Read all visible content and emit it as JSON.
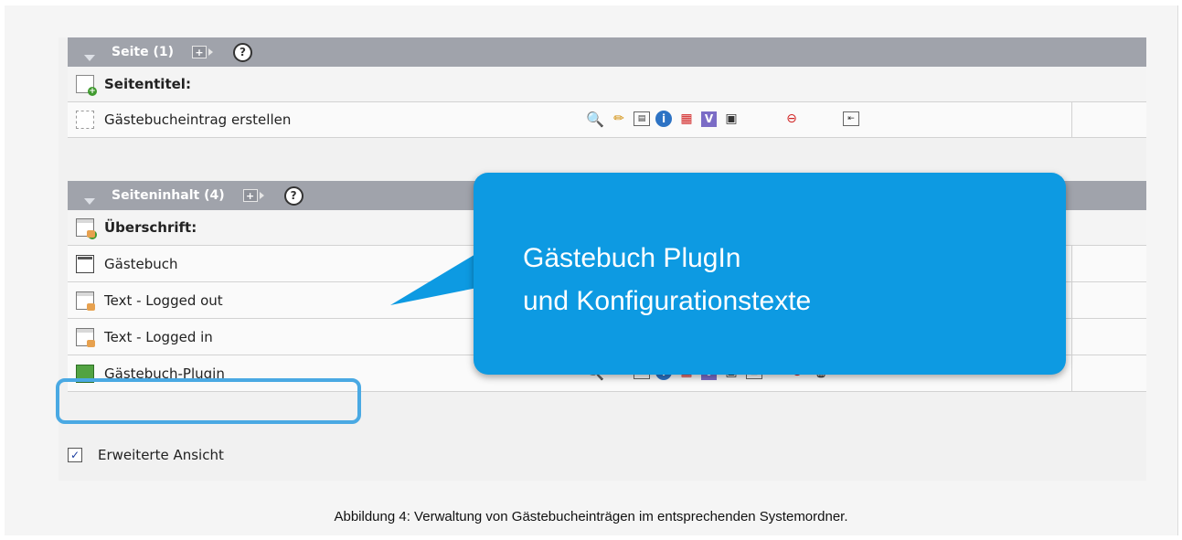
{
  "sections": [
    {
      "title": "Seite (1)",
      "help": "?",
      "head_label": "Seitentitel:",
      "rows": [
        {
          "label": "Gästebucheintrag erstellen"
        }
      ]
    },
    {
      "title": "Seiteninhalt (4)",
      "help": "?",
      "head_label": "Überschrift:",
      "rows": [
        {
          "label": "Gästebuch"
        },
        {
          "label": "Text - Logged out"
        },
        {
          "label": "Text - Logged in"
        },
        {
          "label": "Gästebuch-Plugin"
        }
      ]
    }
  ],
  "row_icons": [
    "magnifier-icon",
    "pencil-icon",
    "page-move-icon",
    "info-icon",
    "calendar-icon",
    "v-icon",
    "new-content-icon",
    "hide-icon",
    "move-up-icon"
  ],
  "toolbar_glyphs": {
    "v": "V",
    "plus": "+",
    "checkmark": "✓"
  },
  "extended_view": {
    "label": "Erweiterte Ansicht",
    "checked": true
  },
  "callout": {
    "line1": "Gästebuch PlugIn",
    "line2": "und Konfigurationstexte"
  },
  "caption": "Abbildung 4: Verwaltung von Gästebucheinträgen im entsprechenden Systemordner.",
  "colors": {
    "header": "#a0a3ab",
    "callout": "#0d9ae2",
    "highlight": "#4aa9e3"
  }
}
